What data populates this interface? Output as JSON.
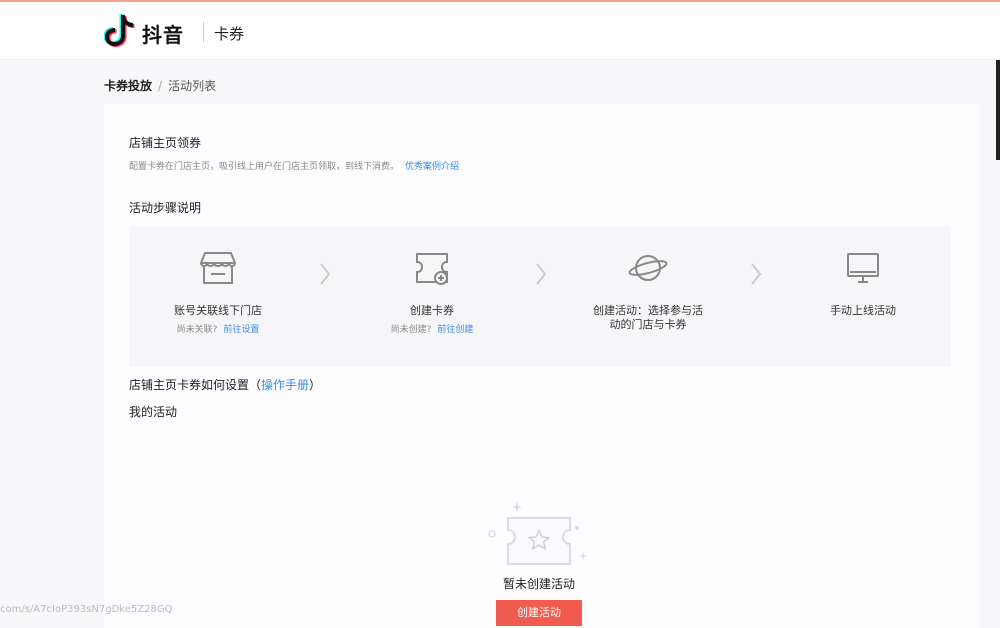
{
  "header": {
    "brand": "抖音",
    "product": "卡券",
    "logo_icon": "douyin-logo-icon"
  },
  "breadcrumb": {
    "parent": "卡券投放",
    "separator": "/",
    "current": "活动列表"
  },
  "section": {
    "title": "店铺主页领券",
    "description": "配置卡券在门店主页，吸引线上用户在门店主页领取，到线下消费。",
    "description_link": "优秀案例介绍"
  },
  "steps_title": "活动步骤说明",
  "steps": [
    {
      "icon": "store-icon",
      "label": "账号关联线下门店",
      "sub_text": "尚未关联?",
      "sub_link": "前往设置"
    },
    {
      "icon": "coupon-icon",
      "label": "创建卡券",
      "sub_text": "尚未创建?",
      "sub_link": "前往创建"
    },
    {
      "icon": "planet-icon",
      "label_line1": "创建活动：选择参与活",
      "label_line2": "动的门店与卡券"
    },
    {
      "icon": "monitor-icon",
      "label": "手动上线活动"
    }
  ],
  "howto": {
    "text": "店铺主页卡券如何设置（",
    "link": "操作手册",
    "close": "）"
  },
  "my_activities": {
    "title": "我的活动",
    "empty_text": "暂未创建活动",
    "create_button": "创建活动"
  },
  "status_url": "com/s/A7cIoP393sN7gDke5Z28GQ",
  "colors": {
    "accent_red": "#f25b4f",
    "link_blue": "#3d8de0",
    "top_line": "#f5a48e"
  }
}
